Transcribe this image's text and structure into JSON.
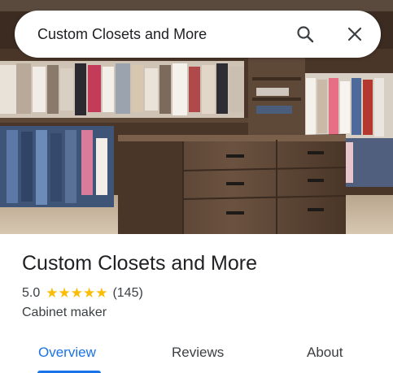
{
  "search": {
    "query": "Custom Closets and More"
  },
  "icons": {
    "search": "search-icon",
    "close": "close-icon"
  },
  "photo": {
    "subject": "walk-in-closet-photo"
  },
  "place": {
    "name": "Custom Closets and More",
    "rating": "5.0",
    "stars": "★★★★★",
    "review_count": "(145)",
    "category": "Cabinet maker"
  },
  "tabs": [
    {
      "label": "Overview",
      "active": true
    },
    {
      "label": "Reviews",
      "active": false
    },
    {
      "label": "About",
      "active": false
    }
  ],
  "colors": {
    "accent": "#1a73e8",
    "star": "#fbbc04",
    "text": "#202124"
  }
}
